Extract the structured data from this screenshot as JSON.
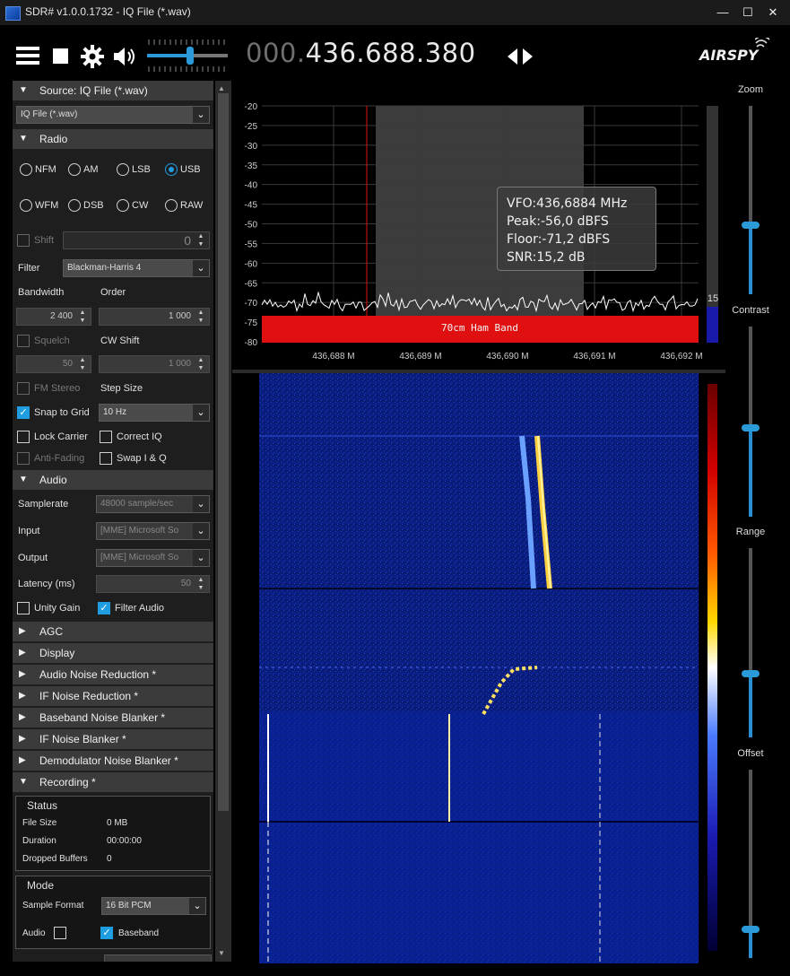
{
  "window": {
    "title": "SDR# v1.0.0.1732 - IQ File (*.wav)",
    "controls": {
      "minimize": "—",
      "maximize": "☐",
      "close": "✕"
    }
  },
  "toolbar": {
    "freq_dim": "000.",
    "freq_bright": "436.688.380",
    "logo": "AIRSPY",
    "volume_level": 0.55
  },
  "source": {
    "header": "Source: IQ File (*.wav)",
    "selected": "IQ File (*.wav)"
  },
  "radio": {
    "header": "Radio",
    "modes": [
      {
        "label": "NFM",
        "selected": false
      },
      {
        "label": "AM",
        "selected": false
      },
      {
        "label": "LSB",
        "selected": false
      },
      {
        "label": "USB",
        "selected": true
      },
      {
        "label": "WFM",
        "selected": false
      },
      {
        "label": "DSB",
        "selected": false
      },
      {
        "label": "CW",
        "selected": false
      },
      {
        "label": "RAW",
        "selected": false
      }
    ],
    "shift_label": "Shift",
    "shift_value": "0",
    "filter_label": "Filter",
    "filter_value": "Blackman-Harris 4",
    "bandwidth_label": "Bandwidth",
    "order_label": "Order",
    "bandwidth_value": "2 400",
    "order_value": "1 000",
    "squelch_label": "Squelch",
    "cwshift_label": "CW Shift",
    "squelch_value": "50",
    "cwshift_value": "1 000",
    "fmstereo_label": "FM Stereo",
    "stepsize_label": "Step Size",
    "snap_label": "Snap to Grid",
    "stepsize_value": "10 Hz",
    "lockcarrier_label": "Lock Carrier",
    "correctiq_label": "Correct IQ",
    "antifading_label": "Anti-Fading",
    "swapiq_label": "Swap I & Q"
  },
  "audio": {
    "header": "Audio",
    "samplerate_label": "Samplerate",
    "samplerate_value": "48000 sample/sec",
    "input_label": "Input",
    "input_value": "[MME] Microsoft So",
    "output_label": "Output",
    "output_value": "[MME] Microsoft So",
    "latency_label": "Latency (ms)",
    "latency_value": "50",
    "unitygain_label": "Unity Gain",
    "filteraudio_label": "Filter Audio"
  },
  "collapsed_sections": [
    "AGC",
    "Display",
    "Audio Noise Reduction *",
    "IF Noise Reduction *",
    "Baseband Noise Blanker *",
    "IF Noise Blanker *",
    "Demodulator Noise Blanker *"
  ],
  "recording": {
    "header": "Recording *",
    "status_title": "Status",
    "file_size_label": "File Size",
    "file_size_value": "0 MB",
    "duration_label": "Duration",
    "duration_value": "00:00:00",
    "dropped_label": "Dropped Buffers",
    "dropped_value": "0",
    "mode_title": "Mode",
    "sample_format_label": "Sample Format",
    "sample_format_value": "16 Bit PCM",
    "audio_label": "Audio",
    "baseband_label": "Baseband"
  },
  "spectrum": {
    "y_ticks": [
      "-20",
      "-25",
      "-30",
      "-35",
      "-40",
      "-45",
      "-50",
      "-55",
      "-60",
      "-65",
      "-70",
      "-75",
      "-80"
    ],
    "x_ticks": [
      "436,688 M",
      "436,689 M",
      "436,690 M",
      "436,691 M",
      "436,692 M"
    ],
    "band_label": "70cm Ham Band",
    "tooltip": {
      "vfo": "VFO:436,6884 MHz",
      "peak": "Peak:-56,0 dBFS",
      "floor": "Floor:-71,2 dBFS",
      "snr": "SNR:15,2 dB"
    },
    "snr_meter_value": "15",
    "colors": {
      "band": "#e01010",
      "grid": "#3a3a3a",
      "trace": "#ffffff",
      "filter": "#3c3c3c"
    }
  },
  "sliders": {
    "zoom_label": "Zoom",
    "contrast_label": "Contrast",
    "range_label": "Range",
    "offset_label": "Offset"
  }
}
